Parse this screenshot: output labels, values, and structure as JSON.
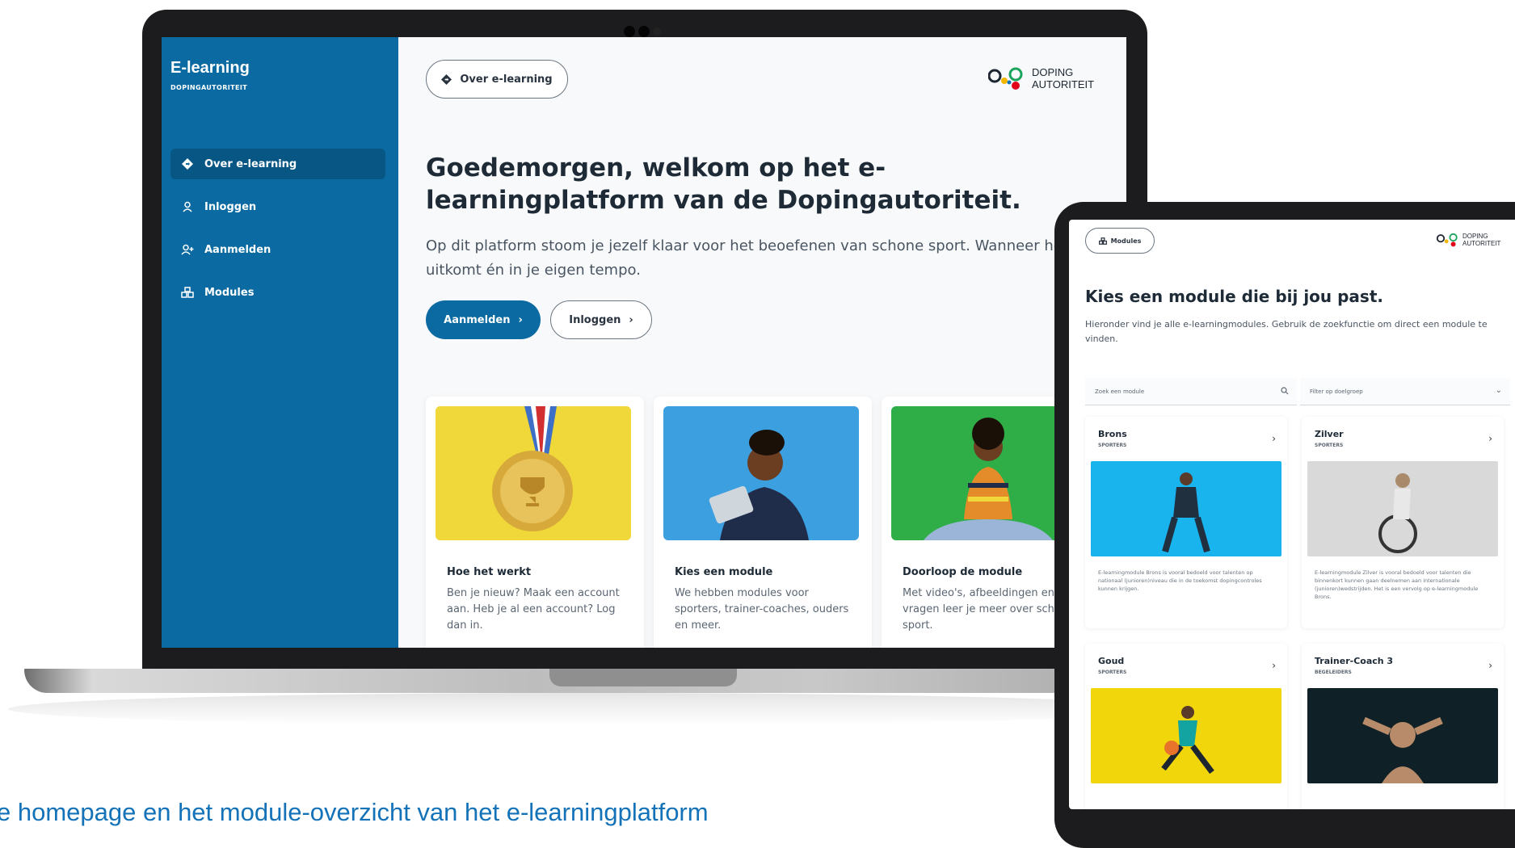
{
  "laptop": {
    "sidebar": {
      "brand_title": "E-learning",
      "brand_sub": "DOPINGAUTORITEIT",
      "items": [
        {
          "label": "Over e-learning",
          "icon": "diamond-direction-icon",
          "active": true
        },
        {
          "label": "Inloggen",
          "icon": "user-icon",
          "active": false
        },
        {
          "label": "Aanmelden",
          "icon": "user-plus-icon",
          "active": false
        },
        {
          "label": "Modules",
          "icon": "modules-icon",
          "active": false
        }
      ]
    },
    "header": {
      "breadcrumb_label": "Over e-learning",
      "logo_line1": "DOPING",
      "logo_line2": "AUTORITEIT"
    },
    "hero": {
      "title": "Goedemorgen, welkom op het e-learningplatform van de Dopingautoriteit.",
      "lead": "Op dit platform stoom je jezelf klaar voor het beoefenen van schone sport. Wanneer het jou uitkomt én in je eigen tempo.",
      "primary_button": "Aanmelden",
      "secondary_button": "Inloggen"
    },
    "cards": [
      {
        "title": "Hoe het werkt",
        "text": "Ben je nieuw? Maak een account aan. Heb je al een account? Log dan in."
      },
      {
        "title": "Kies een module",
        "text": "We hebben modules voor sporters, trainer-coaches, ouders en meer."
      },
      {
        "title": "Doorloop de module",
        "text": "Met video's, afbeeldingen en vragen leer je meer over schone sport."
      }
    ]
  },
  "tablet": {
    "breadcrumb_label": "Modules",
    "logo_line1": "DOPING",
    "logo_line2": "AUTORITEIT",
    "title": "Kies een module die bij jou past.",
    "lead": "Hieronder vind je alle e-learningmodules. Gebruik de zoekfunctie om direct een module te vinden.",
    "search_placeholder": "Zoek een module",
    "filter_label": "Filter op doelgroep",
    "modules": [
      {
        "title": "Brons",
        "audience": "SPORTERS",
        "text": "E-learningmodule Brons is vooral bedoeld voor talenten op nationaal (junioren)niveau die in de toekomst dopingcontroles kunnen krijgen."
      },
      {
        "title": "Zilver",
        "audience": "SPORTERS",
        "text": "E-learningmodule Zilver is vooral bedoeld voor talenten die binnenkort kunnen gaan deelnemen aan internationale (junioren)wedstrijden. Het is een vervolg op e-learningmodule Brons."
      },
      {
        "title": "Goud",
        "audience": "SPORTERS",
        "text": ""
      },
      {
        "title": "Trainer-Coach 3",
        "audience": "BEGELEIDERS",
        "text": ""
      }
    ]
  },
  "caption": "e homepage en het module-overzicht van het e-learningplatform",
  "colors": {
    "brand_blue": "#0a6aa1",
    "caption_blue": "#1472b8",
    "dark_text": "#1e2b37"
  }
}
